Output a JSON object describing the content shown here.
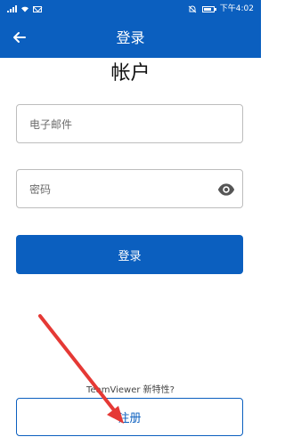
{
  "status_bar": {
    "time": "下午4:02"
  },
  "appbar": {
    "title": "登录",
    "back_icon": "arrow-left-icon"
  },
  "headline": "帐户",
  "email_field": {
    "placeholder": "电子邮件",
    "value": ""
  },
  "password_field": {
    "placeholder": "密码",
    "value": "",
    "toggle_icon": "eye-icon"
  },
  "login_button": {
    "label": "登录"
  },
  "whats_new": "TeamViewer 新特性?",
  "register_button": {
    "label": "注册"
  },
  "colors": {
    "brand_blue": "#0b5fbf",
    "annotation_red": "#e53935"
  }
}
